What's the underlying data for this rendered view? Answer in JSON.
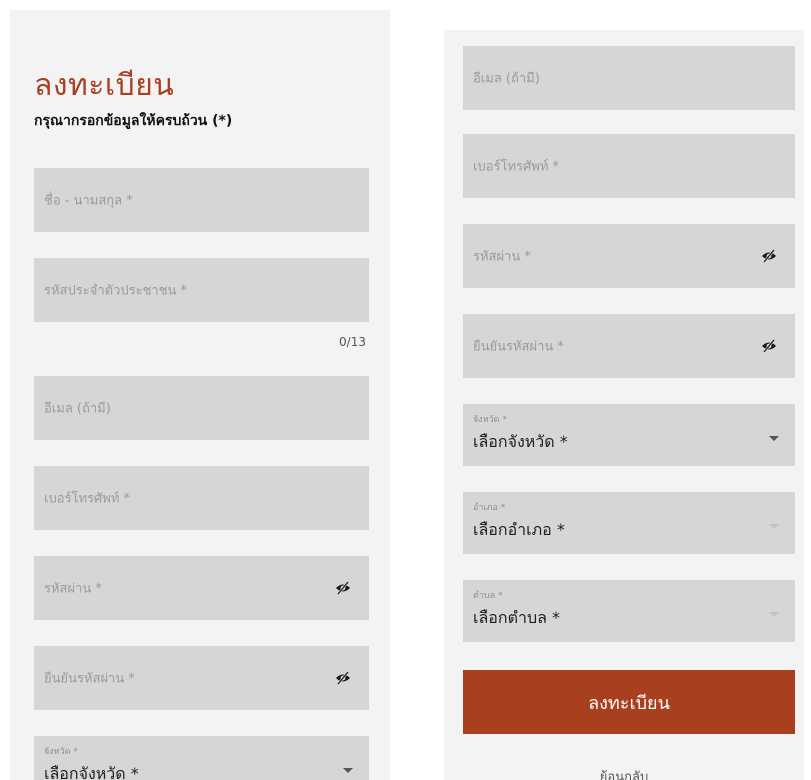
{
  "title": "ลงทะเบียน",
  "subtitle": "กรุณากรอกข้อมูลให้ครบถ้วน (*)",
  "fields": {
    "fullname": "ชื่อ - นามสกุล *",
    "citizen_id": "รหัสประจำตัวประชาชน *",
    "citizen_id_counter": "0/13",
    "email": "อีเมล (ถ้ามี)",
    "phone": "เบอร์โทรศัพท์ *",
    "password": "รหัสผ่าน *",
    "confirm_password": "ยืนยันรหัสผ่าน *"
  },
  "selects": {
    "province": {
      "label": "จังหวัด *",
      "value": "เลือกจังหวัด *",
      "enabled": true
    },
    "district": {
      "label": "อำเภอ *",
      "value": "เลือกอำเภอ *",
      "enabled": false
    },
    "subdistrict": {
      "label": "ตำบล *",
      "value": "เลือกตำบล *",
      "enabled": false
    }
  },
  "submit_label": "ลงทะเบียน",
  "back_label": "ย้อนกลับ",
  "icons": {
    "password_toggle": "eye-slash-icon",
    "dropdown": "caret-down-icon"
  },
  "colors": {
    "accent": "#a8401f",
    "field_bg": "#d6d6d6",
    "panel_bg": "#f3f3f3",
    "placeholder": "#9a9a9a"
  }
}
